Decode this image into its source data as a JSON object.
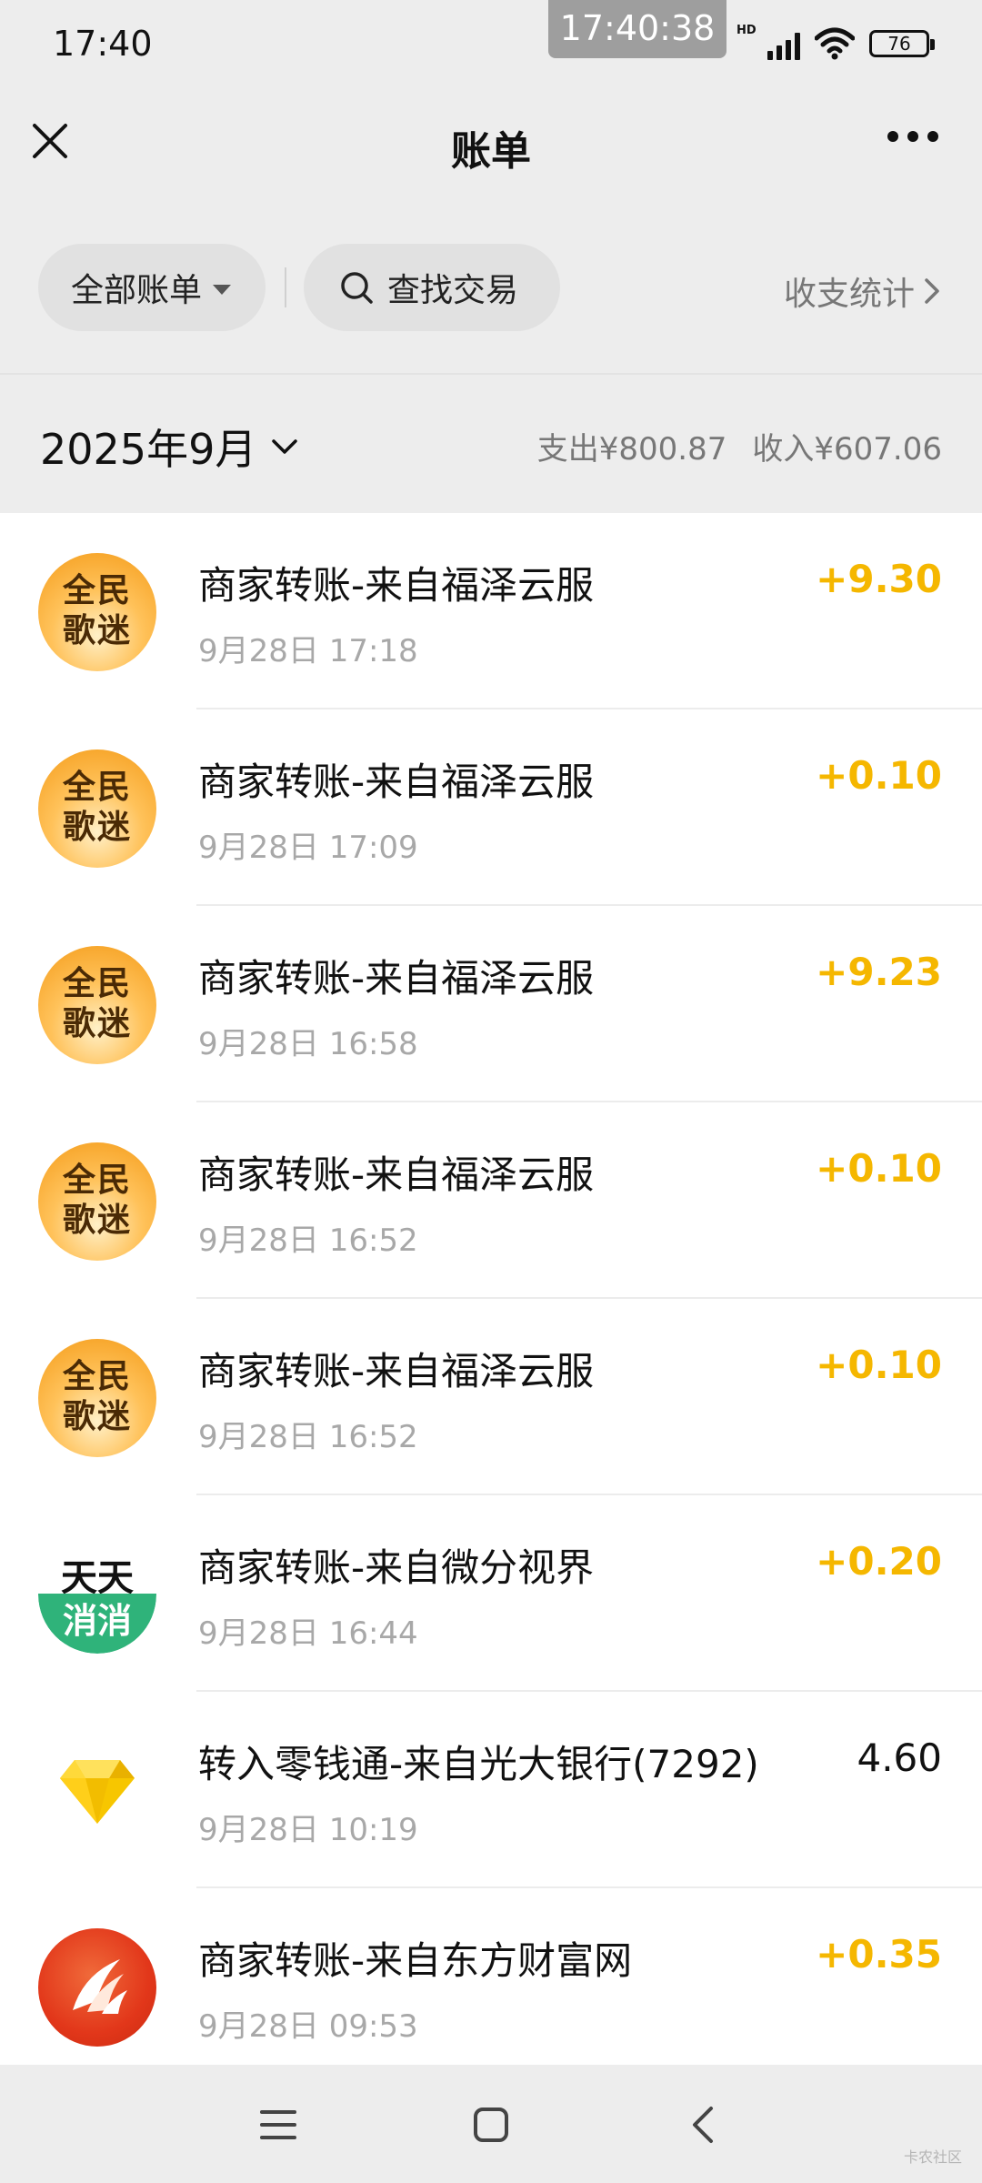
{
  "status_bar": {
    "time": "17:40",
    "overlay_clock": "17:40:38",
    "network_label": "HD",
    "battery": "76"
  },
  "nav": {
    "title": "账单",
    "close_icon": "close-icon",
    "more_icon": "more-icon"
  },
  "filters": {
    "all_bills": "全部账单",
    "search": "查找交易",
    "stats": "收支统计"
  },
  "month": {
    "label": "2025年9月",
    "expense": "支出¥800.87",
    "income": "收入¥607.06"
  },
  "transactions": [
    {
      "icon": "quanmin-geshi",
      "icon_text_1": "全民",
      "icon_text_2": "歌迷",
      "title": "商家转账-来自福泽云服",
      "time": "9月28日 17:18",
      "amount": "+9.30"
    },
    {
      "icon": "quanmin-geshi",
      "icon_text_1": "全民",
      "icon_text_2": "歌迷",
      "title": "商家转账-来自福泽云服",
      "time": "9月28日 17:09",
      "amount": "+0.10"
    },
    {
      "icon": "quanmin-geshi",
      "icon_text_1": "全民",
      "icon_text_2": "歌迷",
      "title": "商家转账-来自福泽云服",
      "time": "9月28日 16:58",
      "amount": "+9.23"
    },
    {
      "icon": "quanmin-geshi",
      "icon_text_1": "全民",
      "icon_text_2": "歌迷",
      "title": "商家转账-来自福泽云服",
      "time": "9月28日 16:52",
      "amount": "+0.10"
    },
    {
      "icon": "quanmin-geshi",
      "icon_text_1": "全民",
      "icon_text_2": "歌迷",
      "title": "商家转账-来自福泽云服",
      "time": "9月28日 16:52",
      "amount": "+0.10"
    },
    {
      "icon": "tiantian-xiaoxiao",
      "icon_text_1": "天天",
      "icon_text_2": "消消",
      "title": "商家转账-来自微分视界",
      "time": "9月28日 16:44",
      "amount": "+0.20"
    },
    {
      "icon": "diamond-icon",
      "title": "转入零钱通-来自光大银行(7292)",
      "time": "9月28日 10:19",
      "amount": "4.60"
    },
    {
      "icon": "dongfang-caifu-icon",
      "title": "商家转账-来自东方财富网",
      "time": "9月28日 09:53",
      "amount": "+0.35"
    }
  ],
  "colors": {
    "income_amount": "#f5b700",
    "background": "#ededed"
  },
  "watermark": "卡农社区"
}
